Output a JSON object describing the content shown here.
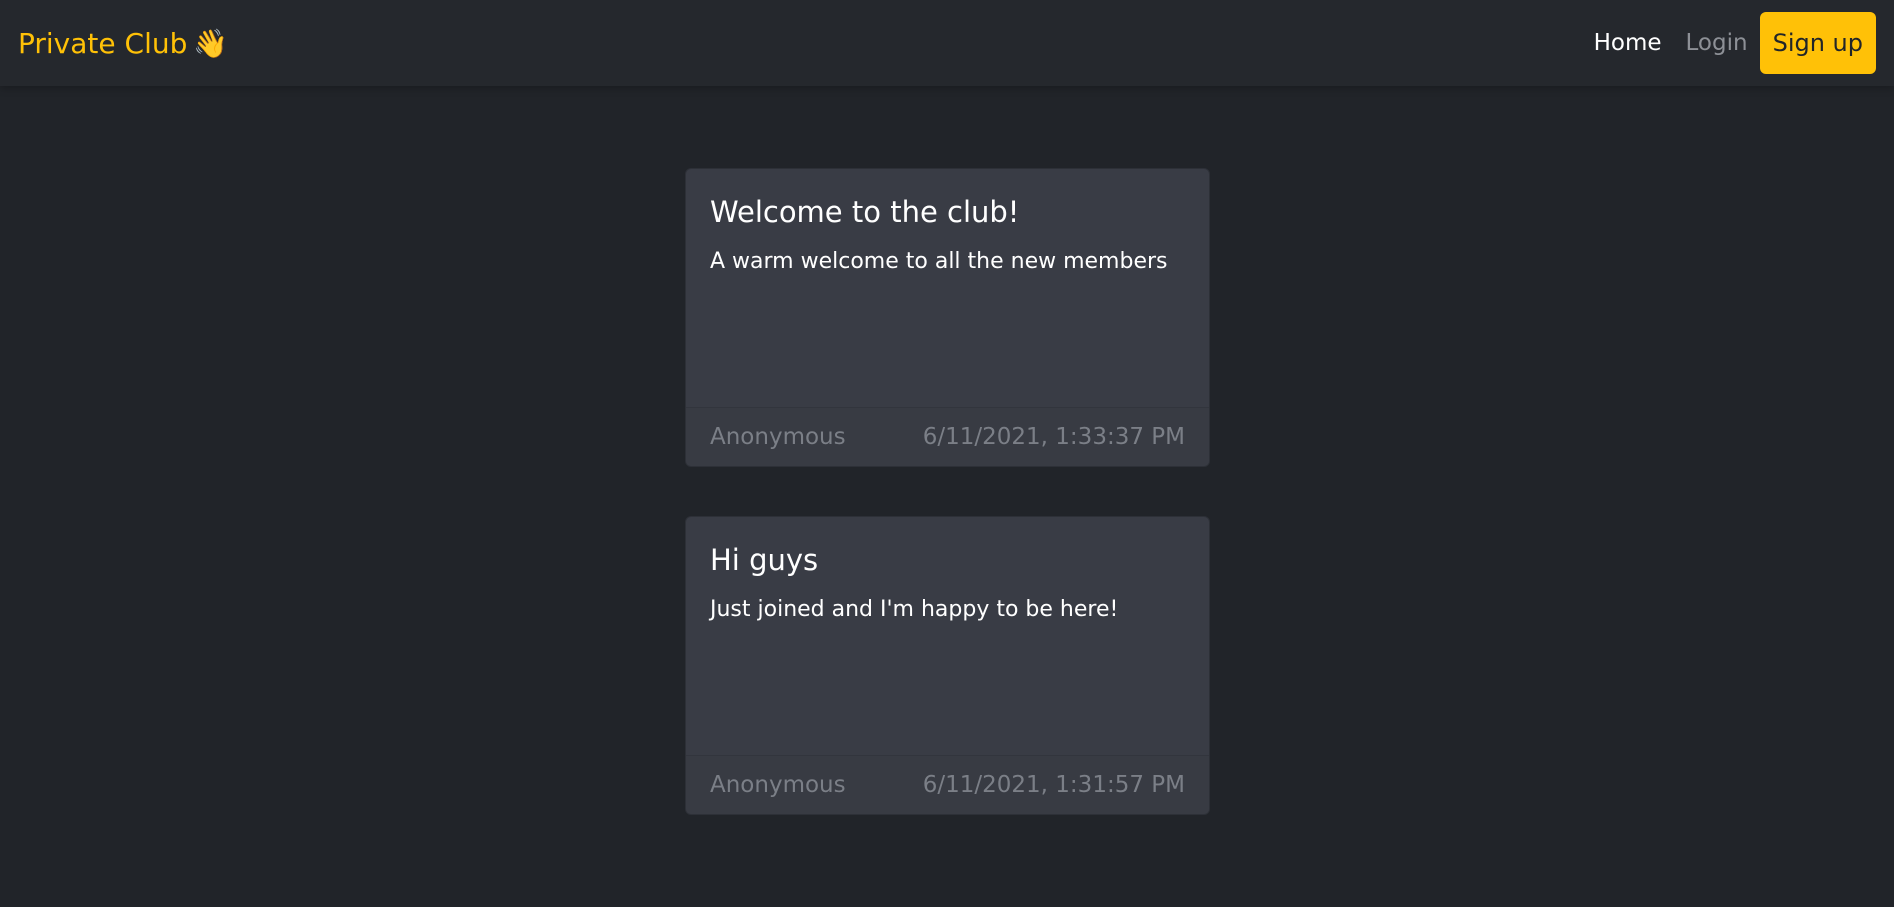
{
  "navbar": {
    "brand": "Private Club",
    "brand_emoji": "👋",
    "links": {
      "home": "Home",
      "login": "Login",
      "signup": "Sign up"
    },
    "colors": {
      "brand": "#ffc107",
      "background": "#25282d"
    }
  },
  "messages": [
    {
      "title": "Welcome to the club!",
      "text": "A warm welcome to all the new members",
      "author": "Anonymous",
      "timestamp": "6/11/2021, 1:33:37 PM"
    },
    {
      "title": "Hi guys",
      "text": "Just joined and I'm happy to be here!",
      "author": "Anonymous",
      "timestamp": "6/11/2021, 1:31:57 PM"
    }
  ]
}
